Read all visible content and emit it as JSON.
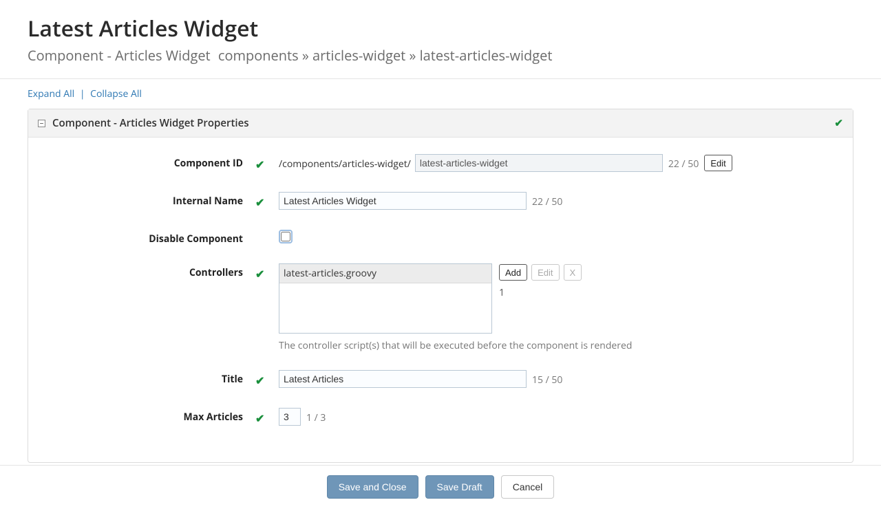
{
  "header": {
    "title": "Latest Articles Widget",
    "subtitle": "Component - Articles Widget",
    "breadcrumb": "components » articles-widget » latest-articles-widget"
  },
  "toolbar": {
    "expand_all": "Expand All",
    "collapse_all": "Collapse All"
  },
  "panel": {
    "title": "Component - Articles Widget Properties"
  },
  "fields": {
    "component_id": {
      "label": "Component ID",
      "prefix": "/components/articles-widget/",
      "value": "latest-articles-widget",
      "counter": "22 / 50",
      "edit_btn": "Edit"
    },
    "internal_name": {
      "label": "Internal Name",
      "value": "Latest Articles Widget",
      "counter": "22 / 50"
    },
    "disable_component": {
      "label": "Disable Component",
      "checked": false
    },
    "controllers": {
      "label": "Controllers",
      "items": [
        "latest-articles.groovy"
      ],
      "count": "1",
      "add_btn": "Add",
      "edit_btn": "Edit",
      "x_btn": "X",
      "help": "The controller script(s) that will be executed before the component is rendered"
    },
    "title": {
      "label": "Title",
      "value": "Latest Articles",
      "counter": "15 / 50"
    },
    "max_articles": {
      "label": "Max Articles",
      "value": "3",
      "counter": "1 / 3"
    }
  },
  "footer": {
    "save_close": "Save and Close",
    "save_draft": "Save Draft",
    "cancel": "Cancel"
  }
}
